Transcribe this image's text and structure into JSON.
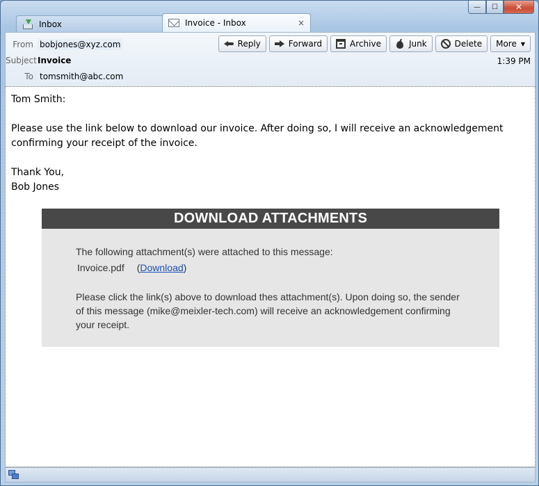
{
  "window": {
    "minimize": "—",
    "maximize": "☐",
    "close": "✕"
  },
  "tabs": [
    {
      "label": "Inbox",
      "icon": "inbox-icon"
    },
    {
      "label": "Invoice - Inbox",
      "icon": "envelope-icon",
      "close": "×"
    }
  ],
  "header": {
    "from_label": "From",
    "from_value": "bobjones@xyz.com",
    "subject_label": "Subject",
    "subject_value": "Invoice",
    "to_label": "To",
    "to_value": "tomsmith@abc.com",
    "time": "1:39 PM"
  },
  "toolbar": {
    "reply": "Reply",
    "forward": "Forward",
    "archive": "Archive",
    "junk": "Junk",
    "delete": "Delete",
    "more": "More",
    "more_caret": "▼"
  },
  "message": {
    "greeting": "Tom Smith:",
    "paragraph_line1": "Please use the link below to download our invoice.  After doing so, I will receive an acknowledgement",
    "paragraph_line2": "confirming your receipt of the invoice.",
    "closing": "Thank You,",
    "signature": "Bob Jones"
  },
  "download_box": {
    "title": "DOWNLOAD ATTACHMENTS",
    "intro": "The following attachment(s) were attached to this message:",
    "filename": "Invoice.pdf",
    "open_paren": "(",
    "link": "Download",
    "close_paren": ")",
    "note_line1": "Please click the link(s) above to download thes attachment(s). Upon doing so, the sender",
    "note_line2": "of this message (mike@meixler-tech.com) will receive an acknowledgement confirming",
    "note_line3": "your receipt."
  }
}
